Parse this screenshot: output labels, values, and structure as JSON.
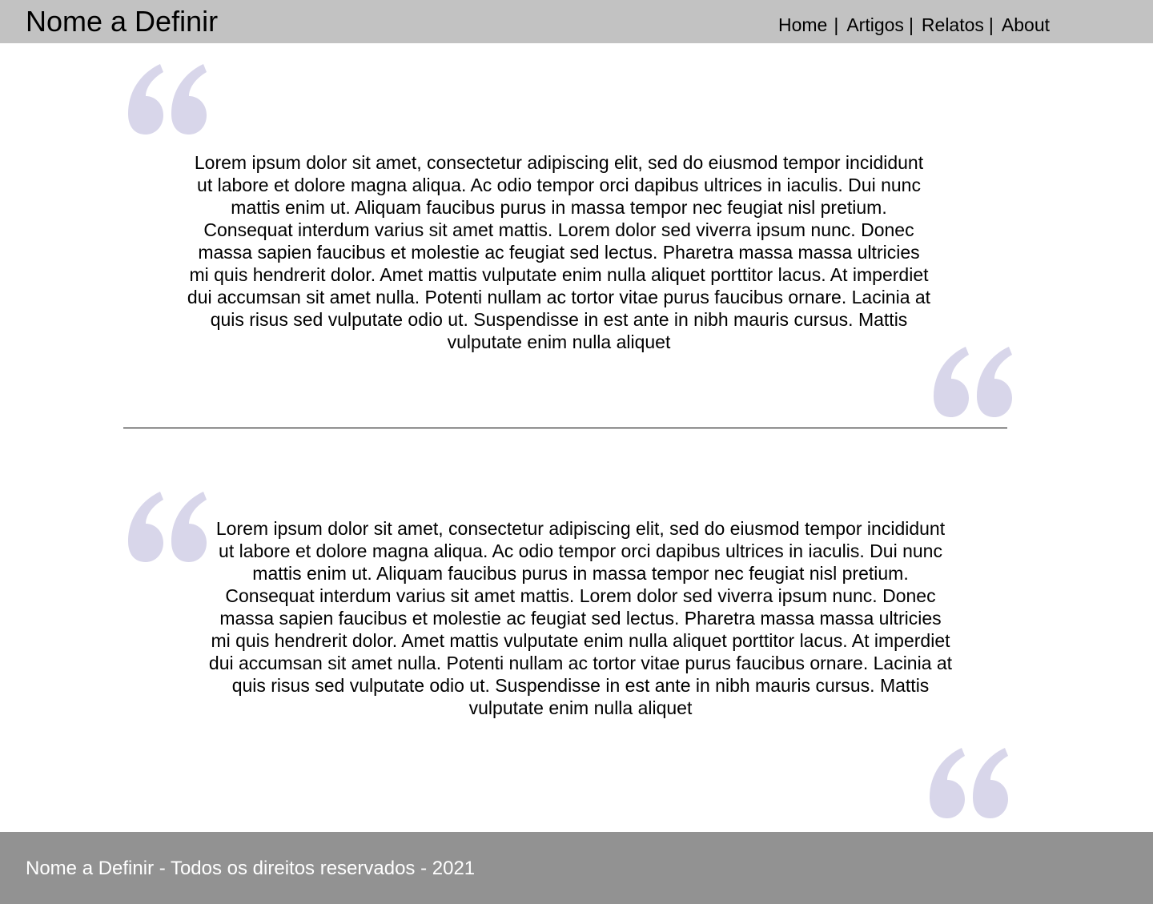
{
  "header": {
    "site_title": "Nome a Definir",
    "nav": {
      "home": "Home",
      "artigos": "Artigos",
      "relatos": "Relatos",
      "about": "About",
      "separator": "|"
    }
  },
  "quotes": [
    {
      "text": "Lorem ipsum dolor sit amet, consectetur adipiscing elit, sed do eiusmod tempor incididunt ut labore et dolore magna aliqua. Ac odio tempor orci dapibus ultrices in iaculis. Dui nunc mattis enim ut. Aliquam faucibus purus in massa tempor nec feugiat nisl pretium. Consequat interdum varius sit amet mattis. Lorem dolor sed viverra ipsum nunc. Donec massa sapien faucibus et molestie ac feugiat sed lectus. Pharetra massa massa ultricies mi quis hendrerit dolor. Amet mattis vulputate enim nulla aliquet porttitor lacus. At imperdiet dui accumsan sit amet nulla. Potenti nullam ac tortor vitae purus faucibus ornare. Lacinia at quis risus sed vulputate odio ut. Suspendisse in est ante in nibh mauris cursus. Mattis vulputate enim nulla aliquet"
    },
    {
      "text": "Lorem ipsum dolor sit amet, consectetur adipiscing elit, sed do eiusmod tempor incididunt ut labore et dolore magna aliqua. Ac odio tempor orci dapibus ultrices in iaculis. Dui nunc mattis enim ut. Aliquam faucibus purus in massa tempor nec feugiat nisl pretium. Consequat interdum varius sit amet mattis. Lorem dolor sed viverra ipsum nunc. Donec massa sapien faucibus et molestie ac feugiat sed lectus. Pharetra massa massa ultricies mi quis hendrerit dolor. Amet mattis vulputate enim nulla aliquet porttitor lacus. At imperdiet dui accumsan sit amet nulla. Potenti nullam ac tortor vitae purus faucibus ornare. Lacinia at quis risus sed vulputate odio ut. Suspendisse in est ante in nibh mauris cursus. Mattis vulputate enim nulla aliquet"
    }
  ],
  "icons": {
    "quote_mark": "open-quote-icon"
  },
  "colors": {
    "header_bg": "#c2c2c2",
    "footer_bg": "#929292",
    "quote_mark": "#d8d6ea"
  },
  "footer": {
    "text": "Nome a Definir - Todos os direitos reservados - 2021"
  }
}
